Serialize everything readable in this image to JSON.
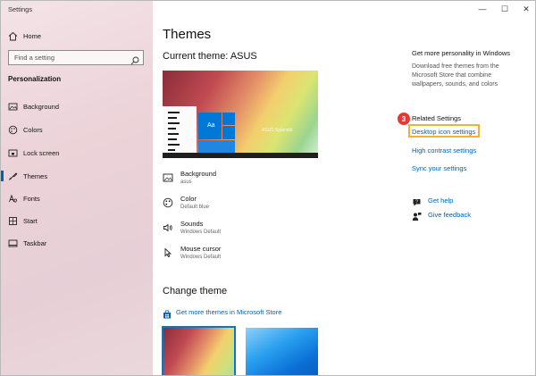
{
  "window": {
    "title": "Settings",
    "controls": {
      "minimize": "—",
      "maximize": "☐",
      "close": "✕"
    }
  },
  "sidebar": {
    "home": "Home",
    "search_placeholder": "Find a setting",
    "section": "Personalization",
    "items": [
      {
        "label": "Background",
        "icon": "image-icon"
      },
      {
        "label": "Colors",
        "icon": "palette-icon"
      },
      {
        "label": "Lock screen",
        "icon": "lock-screen-icon"
      },
      {
        "label": "Themes",
        "icon": "brush-icon",
        "selected": true
      },
      {
        "label": "Fonts",
        "icon": "font-icon"
      },
      {
        "label": "Start",
        "icon": "start-icon"
      },
      {
        "label": "Taskbar",
        "icon": "taskbar-icon"
      }
    ]
  },
  "main": {
    "title": "Themes",
    "current_theme": "Current theme: ASUS",
    "preview": {
      "sample": "Aa",
      "caption": "ASUS Splendid"
    },
    "settings": [
      {
        "title": "Background",
        "value": "asus"
      },
      {
        "title": "Color",
        "value": "Default blue"
      },
      {
        "title": "Sounds",
        "value": "Windows Default"
      },
      {
        "title": "Mouse cursor",
        "value": "Windows Default"
      }
    ],
    "change_theme": "Change theme",
    "store_link": "Get more themes in Microsoft Store"
  },
  "right": {
    "personality_title": "Get more personality in Windows",
    "personality_desc": "Download free themes from the Microsoft Store that combine wallpapers, sounds, and colors",
    "step_badge": "3",
    "related_title": "Related Settings",
    "links": [
      "Desktop icon settings",
      "High contrast settings",
      "Sync your settings"
    ],
    "help": "Get help",
    "feedback": "Give feedback"
  },
  "colors": {
    "accent": "#0063b1",
    "highlight": "#f2b130",
    "badge": "#e53935"
  }
}
